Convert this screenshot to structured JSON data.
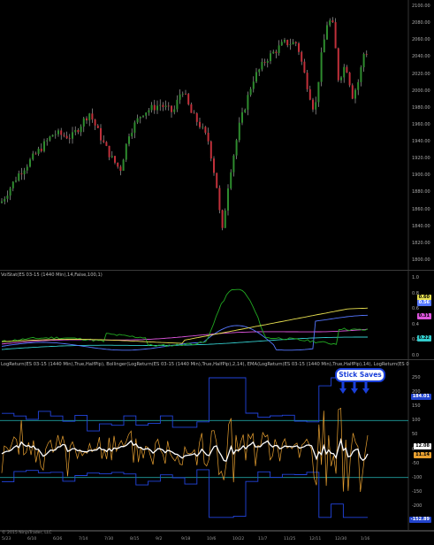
{
  "price_pane": {
    "axis_ticks": [
      "2100.00",
      "2080.00",
      "2060.00",
      "2040.00",
      "2020.00",
      "2000.00",
      "1980.00",
      "1960.00",
      "1940.00",
      "1920.00",
      "1900.00",
      "1880.00",
      "1860.00",
      "1840.00",
      "1820.00",
      "1800.00"
    ],
    "ylim": [
      1795,
      2105
    ],
    "up_color": "#2e8b2e",
    "down_color": "#c0303a"
  },
  "vol_pane": {
    "title": "VolStat(ES 03-15 (1440 Min),14,False,100,1)",
    "axis_ticks": [
      "1.0",
      "0.8",
      "0.6",
      "0.4",
      "0.2",
      "0.0"
    ],
    "tags": [
      {
        "label": "0.60",
        "color": "#e8e050"
      },
      {
        "label": "0.56",
        "color": "#5577ff"
      },
      {
        "label": "0.31",
        "color": "#dd55dd"
      },
      {
        "label": "0.22",
        "color": "#33cccc"
      }
    ]
  },
  "log_pane": {
    "title": "LogReturn(ES 03-15 (1440 Min),True,HalfPip), Bollinger(LogReturn(ES 03-15 (1440 Min),True,HalfPip),2,14), EMA(LogReturn(ES 03-15 (1440 Min),True,HalfPip),14), LogReturn(ES 03-15 (1440 Min),True,HalfPip), LogReturn(E",
    "axis_ticks": [
      "250",
      "200",
      "150",
      "100",
      "50",
      "0",
      "-50",
      "-100",
      "-150",
      "-200",
      "-250"
    ],
    "tags": [
      {
        "label": "184.01",
        "color": "#2244cc"
      },
      {
        "label": "12.08",
        "color": "#ffffff"
      },
      {
        "label": "11.14",
        "color": "#e8a030"
      },
      {
        "label": "-152.89",
        "color": "#2244cc"
      }
    ],
    "annotation": "Stick Saves"
  },
  "date_axis": {
    "labels": [
      "5/23",
      "6/10",
      "6/26",
      "7/14",
      "7/30",
      "8/15",
      "9/2",
      "9/18",
      "10/6",
      "10/22",
      "11/7",
      "11/25",
      "12/11",
      "12/30",
      "1/16"
    ]
  },
  "copyright": "© 2015 NinjaTrader, LLC",
  "colors": {
    "background": "#000000",
    "bollinger": "#2244dd",
    "ema": "#ffffff",
    "logreturn": "#e8a030",
    "threshold": "#20a0a0"
  }
}
